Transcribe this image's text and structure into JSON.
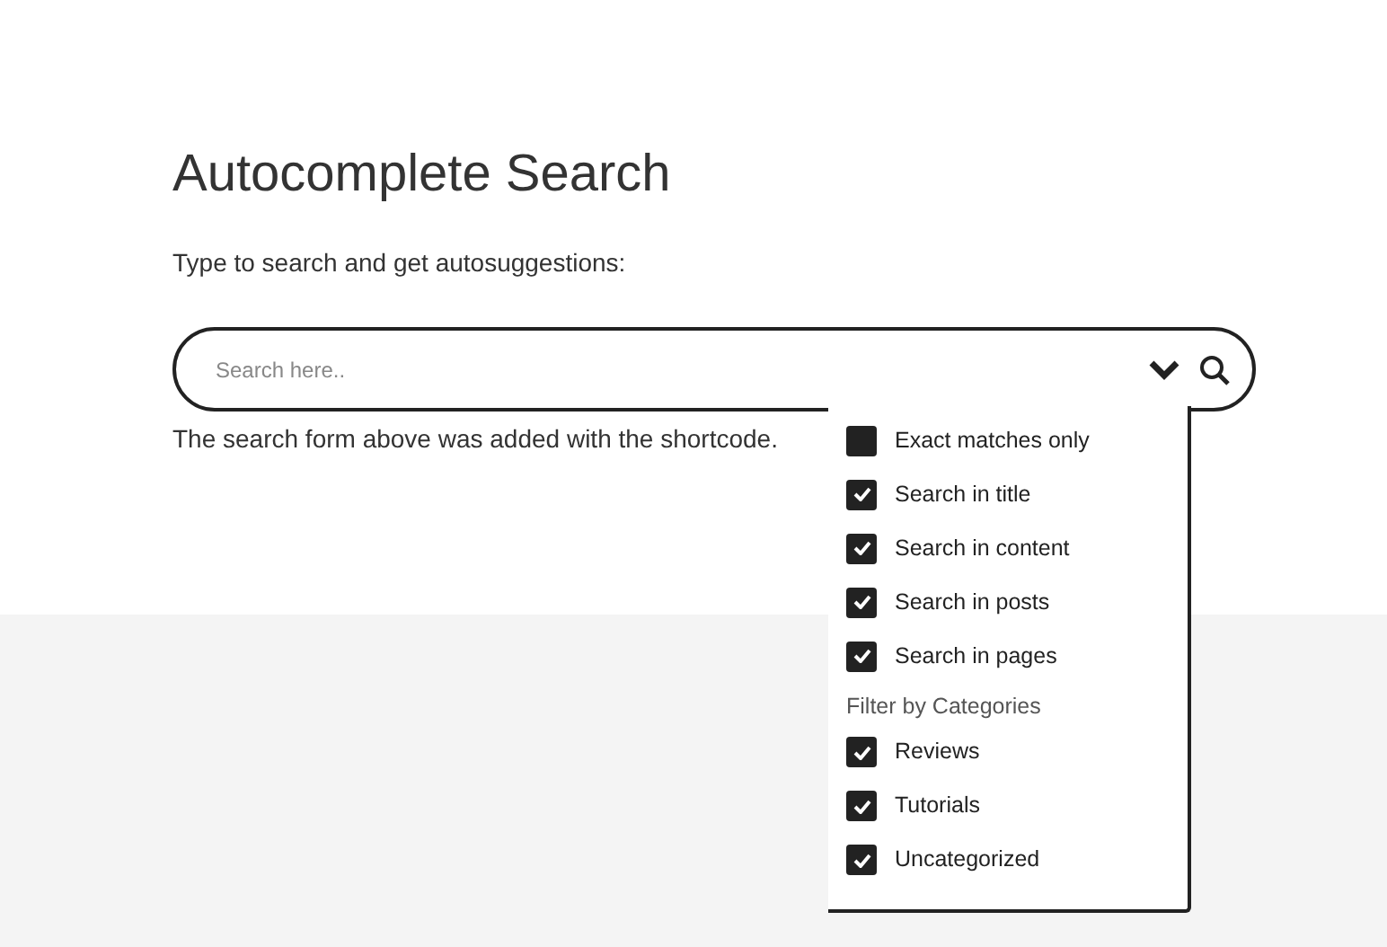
{
  "title": "Autocomplete Search",
  "intro": "Type to search and get autosuggestions:",
  "search": {
    "placeholder": "Search here.."
  },
  "caption": "The search form above was added with the shortcode.",
  "options": [
    {
      "label": "Exact matches only",
      "checked": false
    },
    {
      "label": "Search in title",
      "checked": true
    },
    {
      "label": "Search in content",
      "checked": true
    },
    {
      "label": "Search in posts",
      "checked": true
    },
    {
      "label": "Search in pages",
      "checked": true
    }
  ],
  "categories": {
    "heading": "Filter by Categories",
    "items": [
      {
        "label": "Reviews",
        "checked": true
      },
      {
        "label": "Tutorials",
        "checked": true
      },
      {
        "label": "Uncategorized",
        "checked": true
      }
    ]
  }
}
